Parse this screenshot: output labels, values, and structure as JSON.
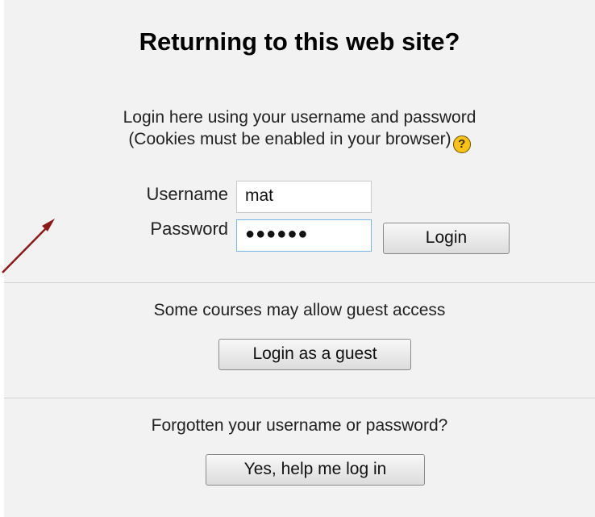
{
  "login": {
    "title": "Returning to this web site?",
    "intro_line1": "Login here using your username and password",
    "intro_line2": "(Cookies must be enabled in your browser)",
    "help_icon": "?",
    "username_label": "Username",
    "username_value": "mat",
    "password_label": "Password",
    "password_value": "●●●●●●",
    "login_button": "Login"
  },
  "guest": {
    "text": "Some courses may allow guest access",
    "button": "Login as a guest"
  },
  "forgot": {
    "text": "Forgotten your username or password?",
    "button": "Yes, help me log in"
  },
  "colors": {
    "panel": "#f2f2f2",
    "arrow": "#8b1a1a",
    "help_icon": "#f7c21a",
    "focus_border": "#7eb4ea"
  }
}
